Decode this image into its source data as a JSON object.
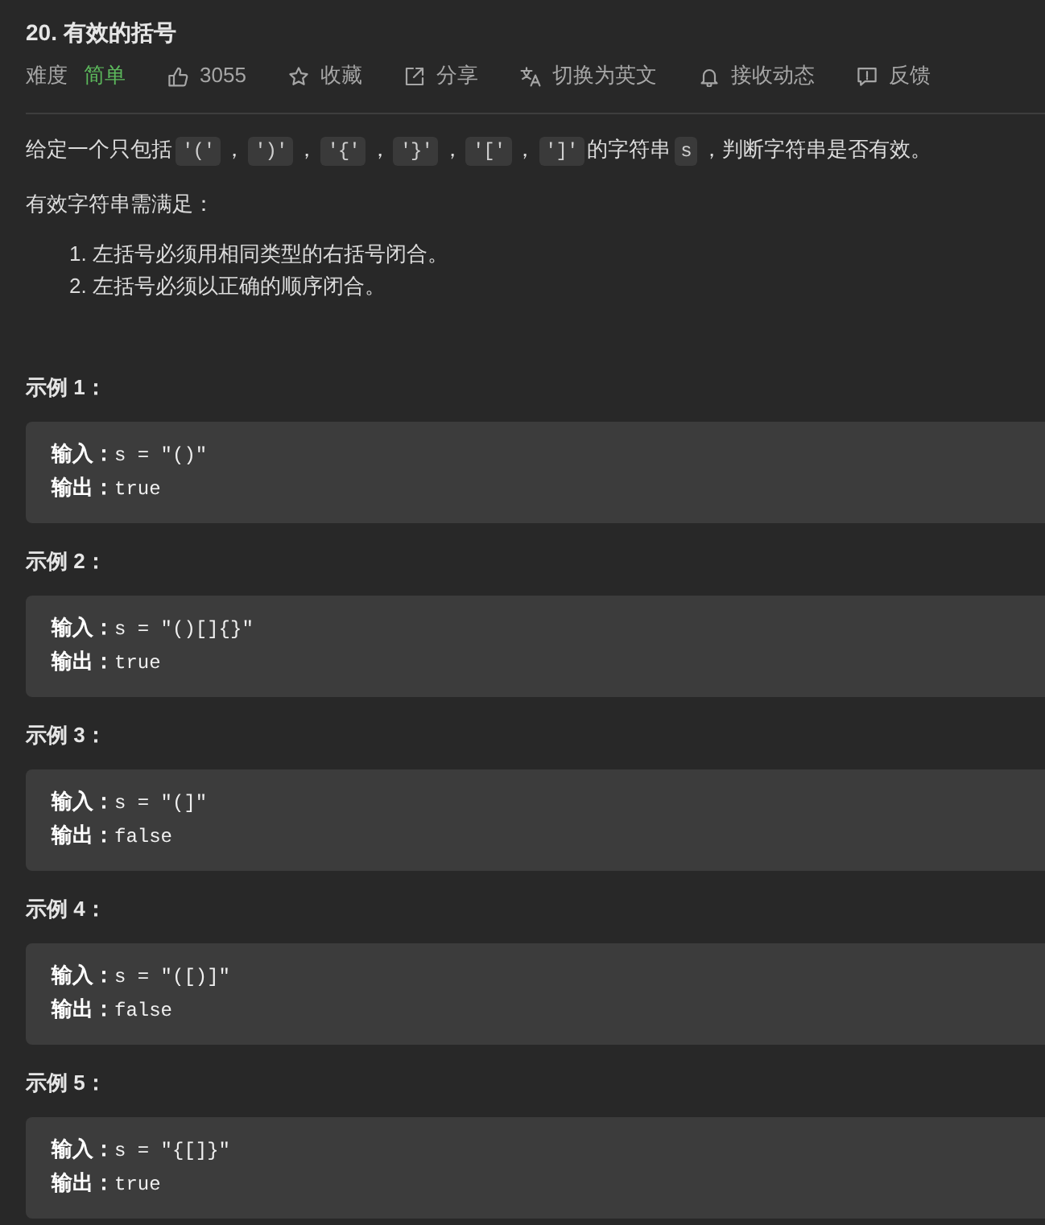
{
  "problem": {
    "title": "20. 有效的括号"
  },
  "meta": {
    "difficulty_label": "难度",
    "difficulty": {
      "label": "简单",
      "kind": "easy"
    },
    "actions": [
      {
        "kind": "like",
        "label": "3055"
      },
      {
        "kind": "favorite",
        "label": "收藏"
      },
      {
        "kind": "share",
        "label": "分享"
      },
      {
        "kind": "translate",
        "label": "切换为英文"
      },
      {
        "kind": "subscribe",
        "label": "接收动态"
      },
      {
        "kind": "feedback",
        "label": "反馈"
      }
    ]
  },
  "description": [
    {
      "kind": "text",
      "text": "给定一个只包括"
    },
    {
      "kind": "code",
      "text": "'('"
    },
    {
      "kind": "text",
      "text": "，"
    },
    {
      "kind": "code",
      "text": "')'"
    },
    {
      "kind": "text",
      "text": "，"
    },
    {
      "kind": "code",
      "text": "'{'"
    },
    {
      "kind": "text",
      "text": "，"
    },
    {
      "kind": "code",
      "text": "'}'"
    },
    {
      "kind": "text",
      "text": "，"
    },
    {
      "kind": "code",
      "text": "'['"
    },
    {
      "kind": "text",
      "text": "，"
    },
    {
      "kind": "code",
      "text": "']'"
    },
    {
      "kind": "text",
      "text": "的字符串"
    },
    {
      "kind": "code",
      "text": "s"
    },
    {
      "kind": "text",
      "text": "，判断字符串是否有效。"
    }
  ],
  "requirements_intro": "有效字符串需满足：",
  "requirements": [
    {
      "number": "1.",
      "text": "左括号必须用相同类型的右括号闭合。"
    },
    {
      "number": "2.",
      "text": "左括号必须以正确的顺序闭合。"
    }
  ],
  "examples": [
    {
      "heading": "示例 1：",
      "lines": [
        "**输入：**s = \"()\"",
        "**输出：**true"
      ]
    },
    {
      "heading": "示例 2：",
      "lines": [
        "**输入：**s = \"()[]{}\"",
        "**输出：**true"
      ]
    },
    {
      "heading": "示例 3：",
      "lines": [
        "**输入：**s = \"(]\"",
        "**输出：**false"
      ]
    },
    {
      "heading": "示例 4：",
      "lines": [
        "**输入：**s = \"([)]\"",
        "**输出：**false"
      ]
    },
    {
      "heading": "示例 5：",
      "lines": [
        "**输入：**s = \"{[]}\"",
        "**输出：**true"
      ]
    }
  ]
}
